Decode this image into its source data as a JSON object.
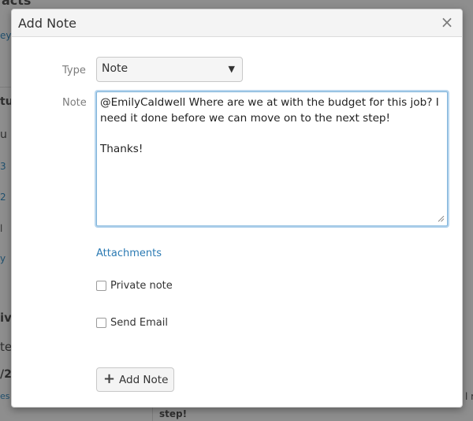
{
  "background": {
    "fragments": [
      "acts",
      "ey",
      "tu",
      "u",
      "3",
      "2",
      "l",
      "y",
      "iv",
      "te",
      "/2",
      "es",
      "l r",
      "step!"
    ]
  },
  "dialog": {
    "title": "Add Note",
    "close_symbol": "×",
    "type_label": "Type",
    "type_value": "Note",
    "type_arrow": "▼",
    "note_label": "Note",
    "note_text": "@EmilyCaldwell Where are we at with the budget for this job? I need it done before we can move on to the next step!\n\nThanks!",
    "attachments_label": "Attachments",
    "private_note_label": "Private note",
    "send_email_label": "Send Email",
    "add_button_icon": "+",
    "add_button_label": "Add Note"
  }
}
